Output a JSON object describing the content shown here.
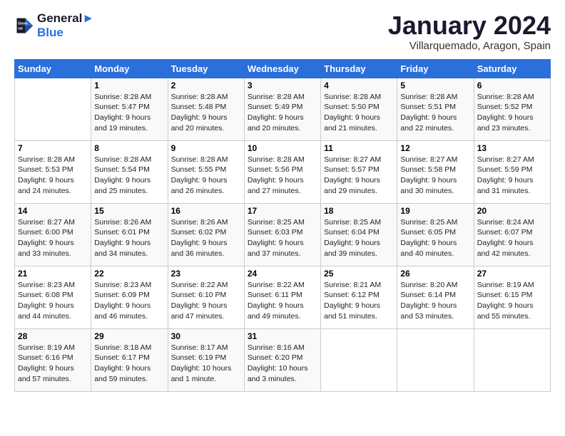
{
  "logo": {
    "line1": "General",
    "line2": "Blue"
  },
  "title": "January 2024",
  "subtitle": "Villarquemado, Aragon, Spain",
  "header_days": [
    "Sunday",
    "Monday",
    "Tuesday",
    "Wednesday",
    "Thursday",
    "Friday",
    "Saturday"
  ],
  "weeks": [
    [
      {
        "day": "",
        "content": ""
      },
      {
        "day": "1",
        "content": "Sunrise: 8:28 AM\nSunset: 5:47 PM\nDaylight: 9 hours\nand 19 minutes."
      },
      {
        "day": "2",
        "content": "Sunrise: 8:28 AM\nSunset: 5:48 PM\nDaylight: 9 hours\nand 20 minutes."
      },
      {
        "day": "3",
        "content": "Sunrise: 8:28 AM\nSunset: 5:49 PM\nDaylight: 9 hours\nand 20 minutes."
      },
      {
        "day": "4",
        "content": "Sunrise: 8:28 AM\nSunset: 5:50 PM\nDaylight: 9 hours\nand 21 minutes."
      },
      {
        "day": "5",
        "content": "Sunrise: 8:28 AM\nSunset: 5:51 PM\nDaylight: 9 hours\nand 22 minutes."
      },
      {
        "day": "6",
        "content": "Sunrise: 8:28 AM\nSunset: 5:52 PM\nDaylight: 9 hours\nand 23 minutes."
      }
    ],
    [
      {
        "day": "7",
        "content": "Sunrise: 8:28 AM\nSunset: 5:53 PM\nDaylight: 9 hours\nand 24 minutes."
      },
      {
        "day": "8",
        "content": "Sunrise: 8:28 AM\nSunset: 5:54 PM\nDaylight: 9 hours\nand 25 minutes."
      },
      {
        "day": "9",
        "content": "Sunrise: 8:28 AM\nSunset: 5:55 PM\nDaylight: 9 hours\nand 26 minutes."
      },
      {
        "day": "10",
        "content": "Sunrise: 8:28 AM\nSunset: 5:56 PM\nDaylight: 9 hours\nand 27 minutes."
      },
      {
        "day": "11",
        "content": "Sunrise: 8:27 AM\nSunset: 5:57 PM\nDaylight: 9 hours\nand 29 minutes."
      },
      {
        "day": "12",
        "content": "Sunrise: 8:27 AM\nSunset: 5:58 PM\nDaylight: 9 hours\nand 30 minutes."
      },
      {
        "day": "13",
        "content": "Sunrise: 8:27 AM\nSunset: 5:59 PM\nDaylight: 9 hours\nand 31 minutes."
      }
    ],
    [
      {
        "day": "14",
        "content": "Sunrise: 8:27 AM\nSunset: 6:00 PM\nDaylight: 9 hours\nand 33 minutes."
      },
      {
        "day": "15",
        "content": "Sunrise: 8:26 AM\nSunset: 6:01 PM\nDaylight: 9 hours\nand 34 minutes."
      },
      {
        "day": "16",
        "content": "Sunrise: 8:26 AM\nSunset: 6:02 PM\nDaylight: 9 hours\nand 36 minutes."
      },
      {
        "day": "17",
        "content": "Sunrise: 8:25 AM\nSunset: 6:03 PM\nDaylight: 9 hours\nand 37 minutes."
      },
      {
        "day": "18",
        "content": "Sunrise: 8:25 AM\nSunset: 6:04 PM\nDaylight: 9 hours\nand 39 minutes."
      },
      {
        "day": "19",
        "content": "Sunrise: 8:25 AM\nSunset: 6:05 PM\nDaylight: 9 hours\nand 40 minutes."
      },
      {
        "day": "20",
        "content": "Sunrise: 8:24 AM\nSunset: 6:07 PM\nDaylight: 9 hours\nand 42 minutes."
      }
    ],
    [
      {
        "day": "21",
        "content": "Sunrise: 8:23 AM\nSunset: 6:08 PM\nDaylight: 9 hours\nand 44 minutes."
      },
      {
        "day": "22",
        "content": "Sunrise: 8:23 AM\nSunset: 6:09 PM\nDaylight: 9 hours\nand 46 minutes."
      },
      {
        "day": "23",
        "content": "Sunrise: 8:22 AM\nSunset: 6:10 PM\nDaylight: 9 hours\nand 47 minutes."
      },
      {
        "day": "24",
        "content": "Sunrise: 8:22 AM\nSunset: 6:11 PM\nDaylight: 9 hours\nand 49 minutes."
      },
      {
        "day": "25",
        "content": "Sunrise: 8:21 AM\nSunset: 6:12 PM\nDaylight: 9 hours\nand 51 minutes."
      },
      {
        "day": "26",
        "content": "Sunrise: 8:20 AM\nSunset: 6:14 PM\nDaylight: 9 hours\nand 53 minutes."
      },
      {
        "day": "27",
        "content": "Sunrise: 8:19 AM\nSunset: 6:15 PM\nDaylight: 9 hours\nand 55 minutes."
      }
    ],
    [
      {
        "day": "28",
        "content": "Sunrise: 8:19 AM\nSunset: 6:16 PM\nDaylight: 9 hours\nand 57 minutes."
      },
      {
        "day": "29",
        "content": "Sunrise: 8:18 AM\nSunset: 6:17 PM\nDaylight: 9 hours\nand 59 minutes."
      },
      {
        "day": "30",
        "content": "Sunrise: 8:17 AM\nSunset: 6:19 PM\nDaylight: 10 hours\nand 1 minute."
      },
      {
        "day": "31",
        "content": "Sunrise: 8:16 AM\nSunset: 6:20 PM\nDaylight: 10 hours\nand 3 minutes."
      },
      {
        "day": "",
        "content": ""
      },
      {
        "day": "",
        "content": ""
      },
      {
        "day": "",
        "content": ""
      }
    ]
  ]
}
